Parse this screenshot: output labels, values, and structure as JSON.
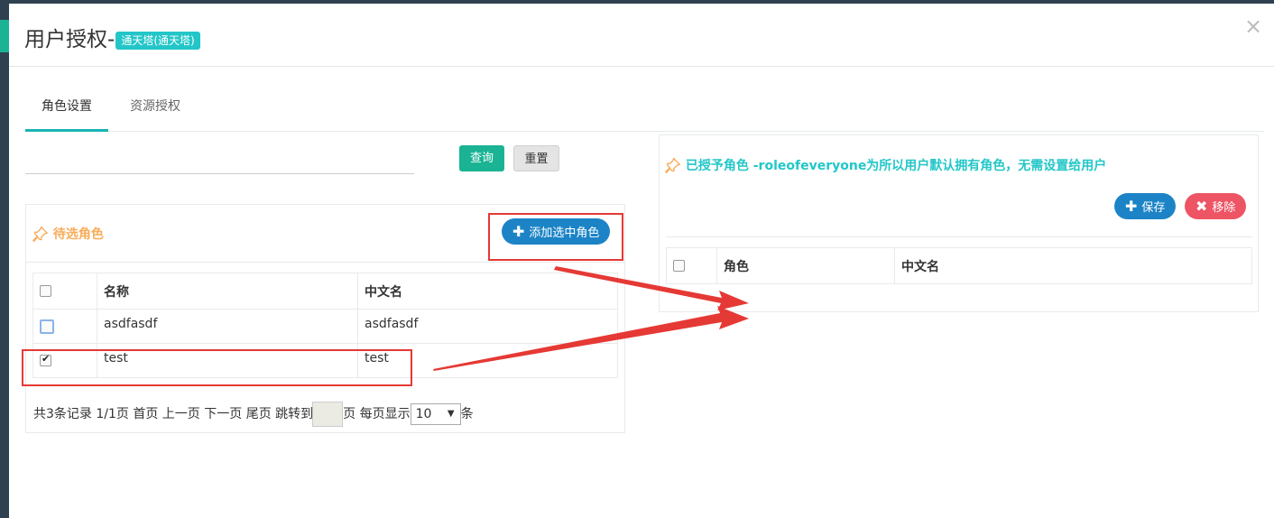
{
  "modal": {
    "title": "用户授权-",
    "badge": "通天塔(通天塔)",
    "close": "×"
  },
  "tabs": [
    {
      "label": "角色设置",
      "active": true
    },
    {
      "label": "资源授权",
      "active": false
    }
  ],
  "search": {
    "value": "",
    "query_label": "查询",
    "reset_label": "重置"
  },
  "left_panel": {
    "title": "待选角色",
    "add_button": "添加选中角色",
    "columns": [
      "名称",
      "中文名"
    ],
    "rows": [
      {
        "name": "asdfasdf",
        "cn_name": "asdfasdf",
        "checked": false
      },
      {
        "name": "test",
        "cn_name": "test",
        "checked": true
      }
    ],
    "pager": {
      "summary": "共3条记录 1/1页 首页 上一页 下一页 尾页 跳转到",
      "page_suffix": "页 每页显示",
      "page_size": "10",
      "unit": "条"
    }
  },
  "right_panel": {
    "title": "已授予角色 -roleofeveryone为所以用户默认拥有角色，无需设置给用户",
    "save_button": "保存",
    "remove_button": "移除",
    "columns": [
      "角色",
      "中文名"
    ]
  },
  "colors": {
    "accent_teal": "#1ab394",
    "info": "#23c6c8",
    "primary": "#1c84c6",
    "danger": "#ed5565",
    "warning": "#f8ac59",
    "annotation_red": "#e53935"
  },
  "icons": [
    "close-icon",
    "pin-icon",
    "plus-icon",
    "times-icon"
  ]
}
